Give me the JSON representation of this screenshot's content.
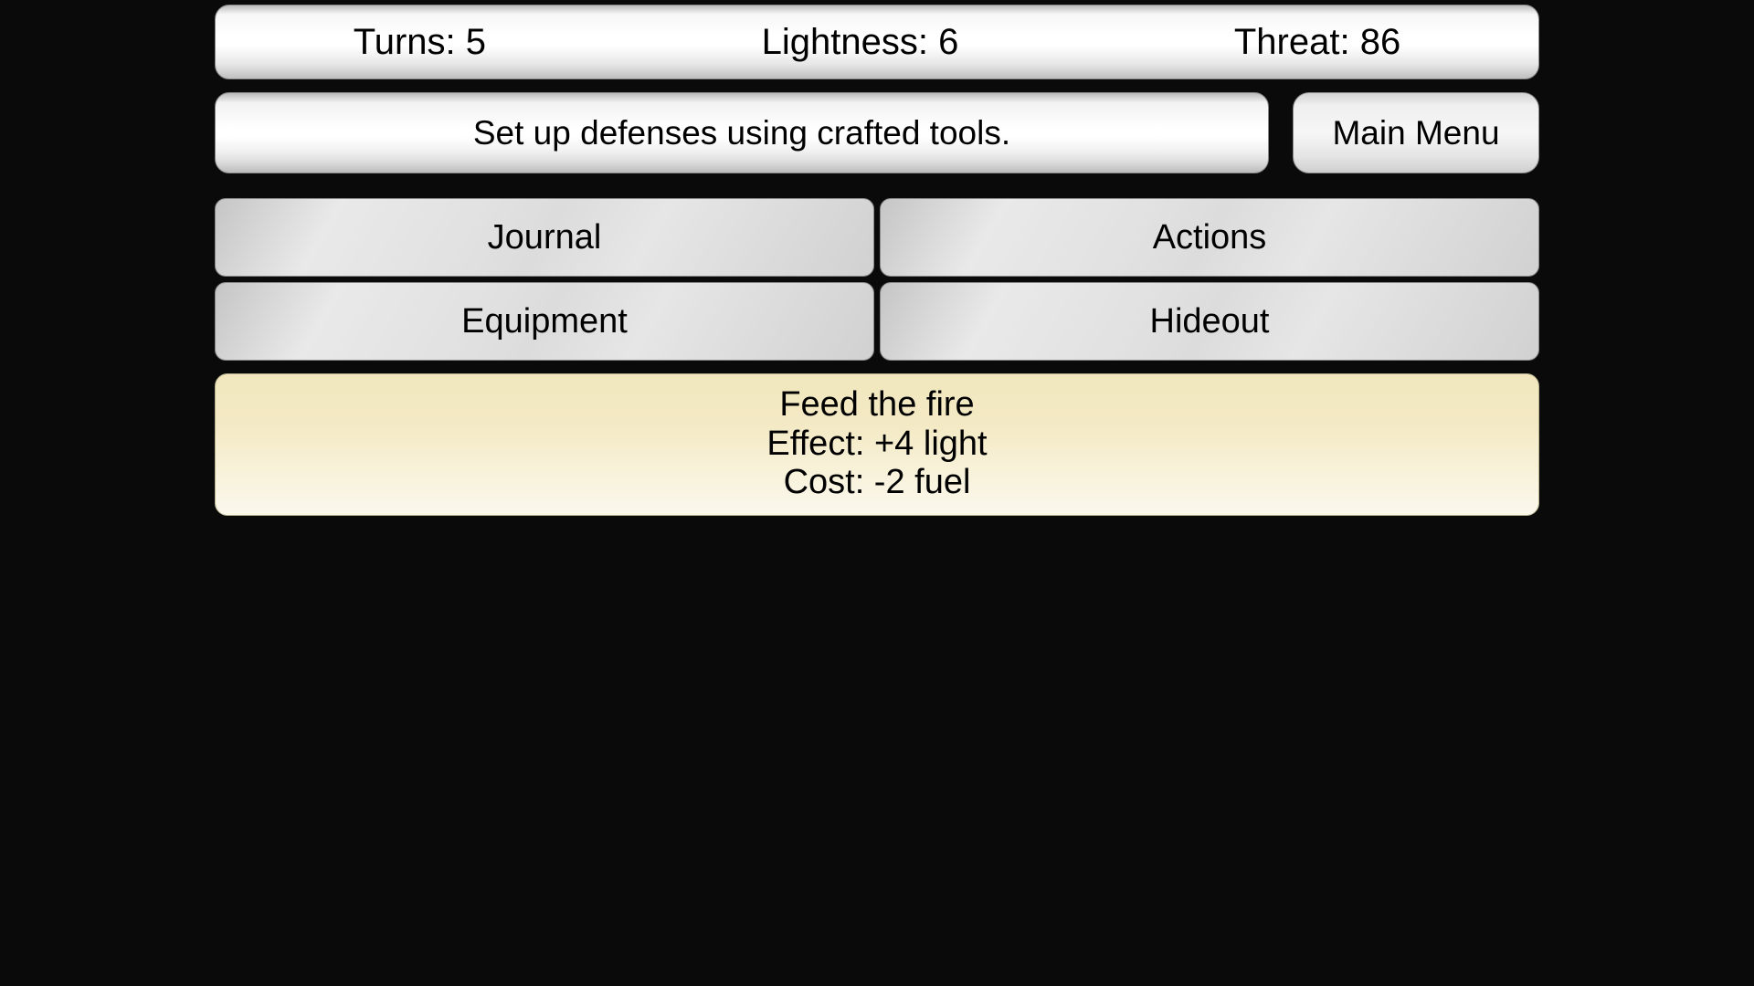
{
  "stats": {
    "turns_label": "Turns:",
    "turns_value": "5",
    "lightness_label": "Lightness:",
    "lightness_value": "6",
    "threat_label": "Threat:",
    "threat_value": "86"
  },
  "objective": {
    "text": "Set up defenses using crafted tools."
  },
  "main_menu": {
    "label": "Main Menu"
  },
  "tabs": {
    "journal": "Journal",
    "actions": "Actions",
    "equipment": "Equipment",
    "hideout": "Hideout"
  },
  "action_card": {
    "title": "Feed the fire",
    "effect": "Effect: +4 light",
    "cost": "Cost: -2 fuel"
  }
}
